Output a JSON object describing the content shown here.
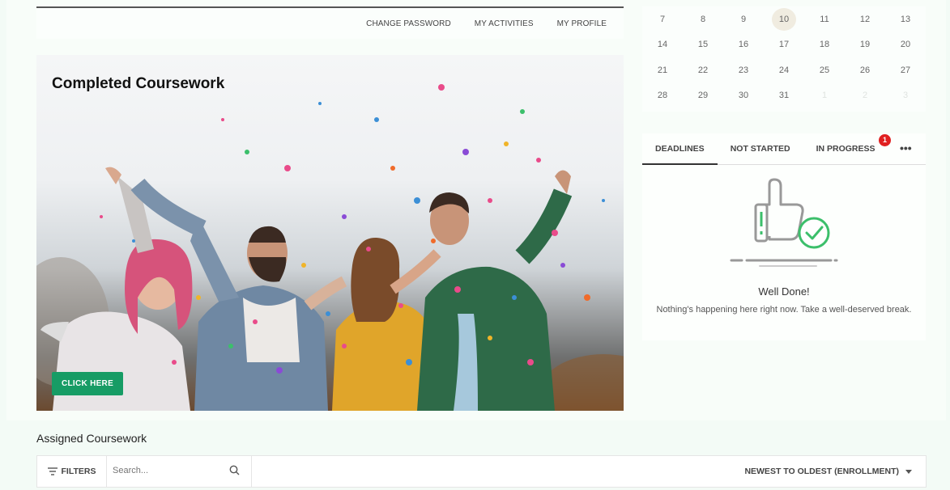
{
  "nav": {
    "links": [
      "CHANGE PASSWORD",
      "MY ACTIVITIES",
      "MY PROFILE"
    ]
  },
  "hero": {
    "title": "Completed Coursework",
    "button_label": "CLICK HERE"
  },
  "calendar": {
    "weeks": [
      [
        "7",
        "8",
        "9",
        "10",
        "11",
        "12",
        "13"
      ],
      [
        "14",
        "15",
        "16",
        "17",
        "18",
        "19",
        "20"
      ],
      [
        "21",
        "22",
        "23",
        "24",
        "25",
        "26",
        "27"
      ],
      [
        "28",
        "29",
        "30",
        "31",
        "1",
        "2",
        "3"
      ]
    ],
    "today": "10"
  },
  "tasks": {
    "tabs": [
      "DEADLINES",
      "NOT STARTED",
      "IN PROGRESS"
    ],
    "active_tab": "DEADLINES",
    "badge_count": "1",
    "empty_title": "Well Done!",
    "empty_text": "Nothing's happening here right now. Take a well-deserved break."
  },
  "assigned": {
    "title": "Assigned Coursework",
    "filters_label": "FILTERS",
    "search_placeholder": "Search...",
    "sort_label": "NEWEST TO OLDEST (ENROLLMENT)"
  },
  "colors": {
    "accent": "#179c65",
    "badge": "#e02020",
    "check": "#3cbf6b"
  }
}
